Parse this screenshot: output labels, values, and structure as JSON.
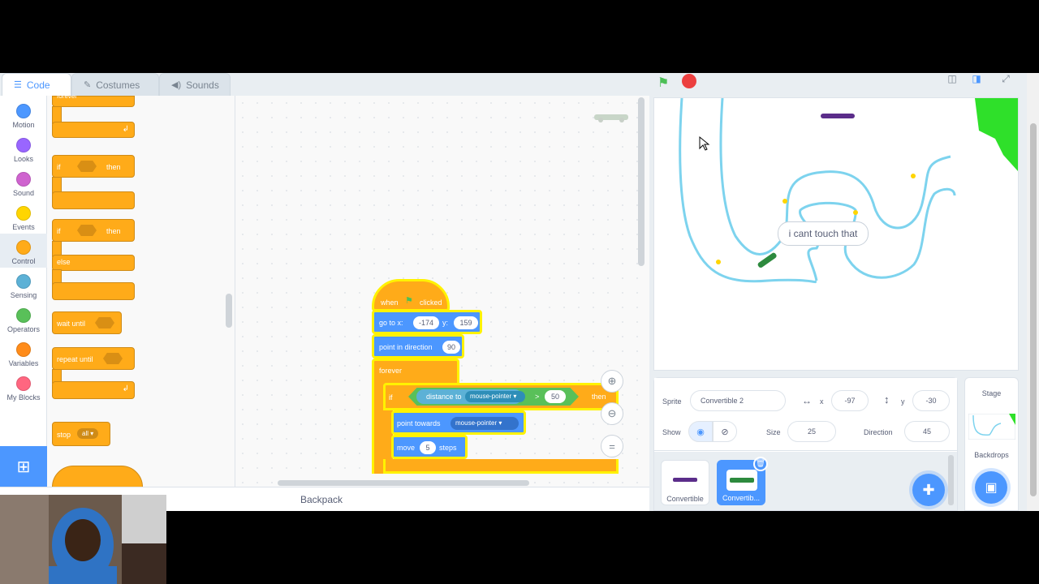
{
  "tabs": [
    {
      "label": "Code",
      "icon": "code-icon",
      "active": true
    },
    {
      "label": "Costumes",
      "icon": "brush-icon",
      "active": false
    },
    {
      "label": "Sounds",
      "icon": "speaker-icon",
      "active": false
    }
  ],
  "categories": [
    {
      "label": "Motion",
      "color": "#4c97ff"
    },
    {
      "label": "Looks",
      "color": "#9966ff"
    },
    {
      "label": "Sound",
      "color": "#cf63cf"
    },
    {
      "label": "Events",
      "color": "#ffd500"
    },
    {
      "label": "Control",
      "color": "#ffab19"
    },
    {
      "label": "Sensing",
      "color": "#5cb1d6"
    },
    {
      "label": "Operators",
      "color": "#59c059"
    },
    {
      "label": "Variables",
      "color": "#ff8c1a"
    },
    {
      "label": "My Blocks",
      "color": "#ff6680"
    }
  ],
  "palette": {
    "forever": "forever",
    "if1": "if",
    "then1": "then",
    "if2": "if",
    "then2": "then",
    "else": "else",
    "wait_until": "wait until",
    "repeat_until": "repeat until",
    "stop": "stop",
    "stop_opt": "all ▾"
  },
  "script": {
    "hat_when": "when",
    "hat_clicked": "clicked",
    "goto": "go to x:",
    "goto_x": "-174",
    "goto_y_label": "y:",
    "goto_y": "159",
    "point_dir": "point in direction",
    "point_dir_val": "90",
    "forever": "forever",
    "if": "if",
    "distance": "distance to",
    "distance_target": "mouse-pointer ▾",
    "gt": ">",
    "gt_val": "50",
    "then": "then",
    "point_towards": "point towards",
    "point_target": "mouse-pointer ▾",
    "move": "move",
    "move_val": "5",
    "steps": "steps"
  },
  "stage": {
    "speech": "i cant touch that"
  },
  "sprite_info": {
    "sprite_label": "Sprite",
    "sprite_name": "Convertible 2",
    "x_label": "x",
    "x": "-97",
    "y_label": "y",
    "y": "-30",
    "show_label": "Show",
    "size_label": "Size",
    "size": "25",
    "direction_label": "Direction",
    "direction": "45"
  },
  "sprites": [
    {
      "label": "Convertible",
      "selected": false
    },
    {
      "label": "Convertib...",
      "selected": true
    }
  ],
  "stage_pane": {
    "title": "Stage",
    "backdrops": "Backdrops"
  },
  "backpack": "Backpack",
  "colors": {
    "accent": "#4c97ff",
    "control": "#ffab19",
    "sensing": "#5cb1d6",
    "operators": "#59c059",
    "highlight": "#fff200"
  }
}
